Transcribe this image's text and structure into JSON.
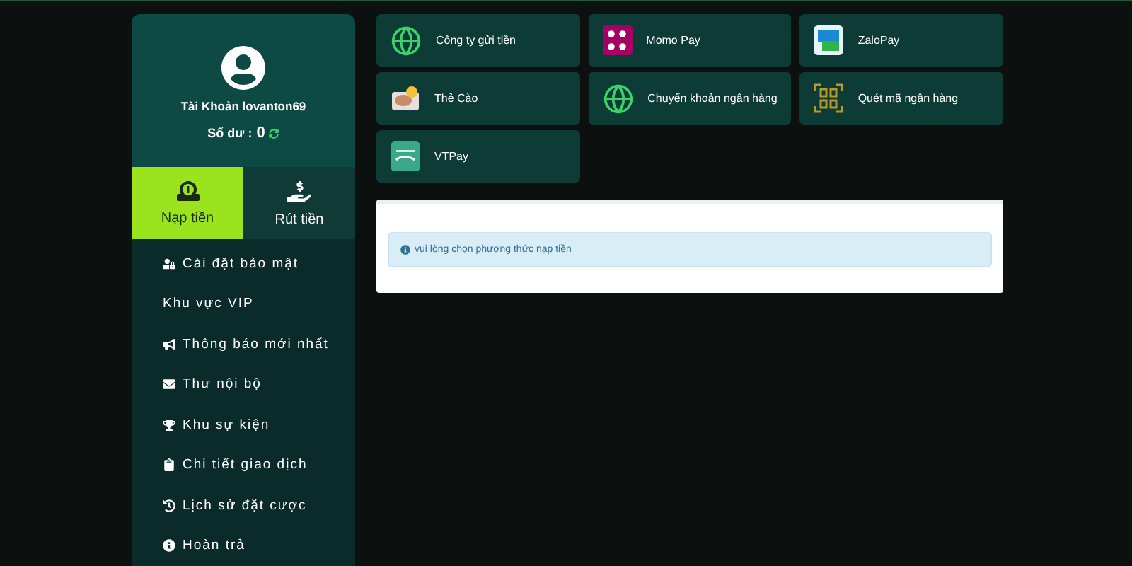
{
  "account": {
    "name": "Tài Khoản lovanton69",
    "balance_label": "Số dư :",
    "balance": "0"
  },
  "tabs": [
    {
      "label": "Nạp tiền",
      "kind": "deposit",
      "selected": true
    },
    {
      "label": "Rút tiền",
      "kind": "withdraw",
      "selected": false
    }
  ],
  "menu": [
    {
      "label": "Cài đặt bảo mật",
      "kind": "security"
    },
    {
      "label": "Khu vực VIP",
      "kind": "plain"
    },
    {
      "label": "Thông báo mới nhất",
      "kind": "news"
    },
    {
      "label": "Thư nội bộ",
      "kind": "mail"
    },
    {
      "label": "Khu sự kiện",
      "kind": "event"
    },
    {
      "label": "Chi tiết giao dịch",
      "kind": "transactions"
    },
    {
      "label": "Lịch sử đặt cược",
      "kind": "history"
    },
    {
      "label": "Hoàn trả",
      "kind": "refund"
    }
  ],
  "methods": [
    {
      "label": "Công ty gửi tiền",
      "kind": "company"
    },
    {
      "label": "Momo Pay",
      "kind": "momo"
    },
    {
      "label": "ZaloPay",
      "kind": "zalo"
    },
    {
      "label": "Thẻ Cào",
      "kind": "card"
    },
    {
      "label": "Chuyển khoản ngân hàng",
      "kind": "bank"
    },
    {
      "label": "Quét mã ngân hàng",
      "kind": "qr"
    },
    {
      "label": "VTPay",
      "kind": "vtpay"
    }
  ],
  "notice": "vui lòng chọn phương thức nạp tiền"
}
